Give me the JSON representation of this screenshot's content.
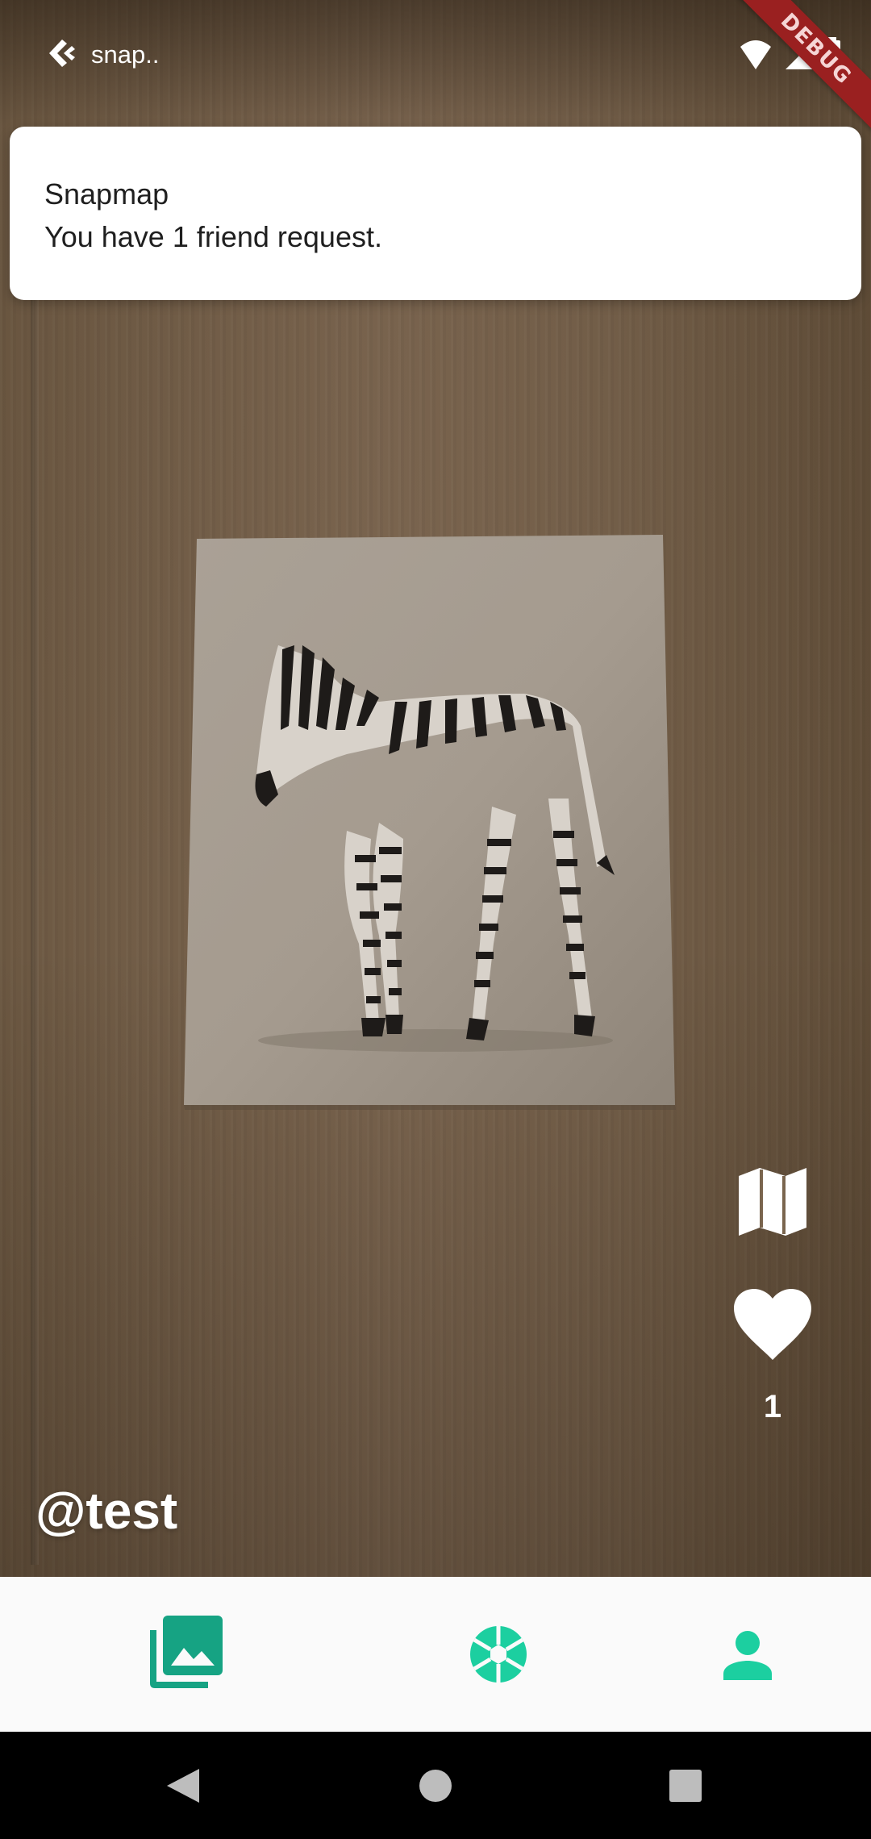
{
  "status_bar": {
    "app_title": "snap..",
    "debug_banner": "DEBUG",
    "icons": [
      "back-arrow-icon",
      "wifi-icon",
      "cell-signal-icon",
      "battery-icon"
    ]
  },
  "notification": {
    "title": "Snapmap",
    "body": "You have 1 friend request."
  },
  "post": {
    "username": "@test",
    "like_count": "1",
    "side_icons": [
      "map-icon",
      "heart-icon"
    ]
  },
  "bottom_nav": {
    "items": [
      {
        "icon": "photo-library-icon"
      },
      {
        "icon": "camera-shutter-icon"
      },
      {
        "icon": "person-icon"
      }
    ],
    "accent_color": "#1ccfa0",
    "dark_accent_color": "#16a383"
  },
  "system_nav": {
    "icons": [
      "back-triangle-icon",
      "home-circle-icon",
      "recents-square-icon"
    ]
  }
}
